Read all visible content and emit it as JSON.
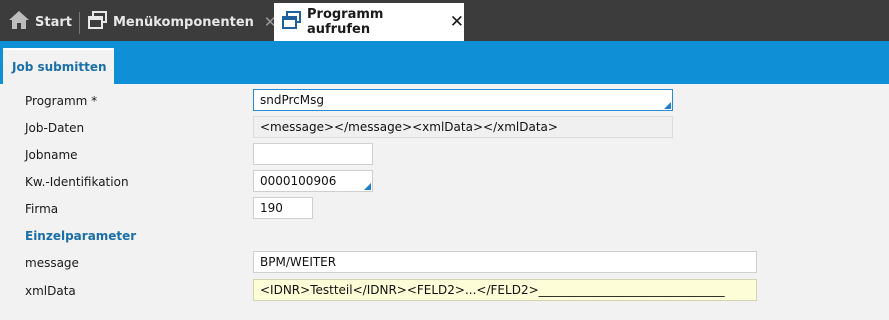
{
  "tabs": {
    "start_label": "Start",
    "menu_label": "Menükomponenten",
    "active_label": "Programm aufrufen",
    "close_glyph": "✕"
  },
  "subtab": {
    "label": "Job submitten"
  },
  "form": {
    "programm_label": "Programm *",
    "programm_value": "sndPrcMsg",
    "jobdaten_label": "Job-Daten",
    "jobdaten_value": "<message></message><xmlData></xmlData>",
    "jobname_label": "Jobname",
    "jobname_value": "",
    "kw_label": "Kw.-Identifikation",
    "kw_value": "0000100906",
    "firma_label": "Firma",
    "firma_value": "190"
  },
  "einzel": {
    "section_label": "Einzelparameter",
    "message_label": "message",
    "message_value": "BPM/WEITER",
    "xmldata_label": "xmlData",
    "xmldata_value": "<IDNR>Testteil</IDNR><FELD2>...</FELD2>_______________________________"
  },
  "colors": {
    "accent": "#0e8fd6",
    "tabbar": "#3c3c3c",
    "label_blue": "#1a6fa8"
  }
}
